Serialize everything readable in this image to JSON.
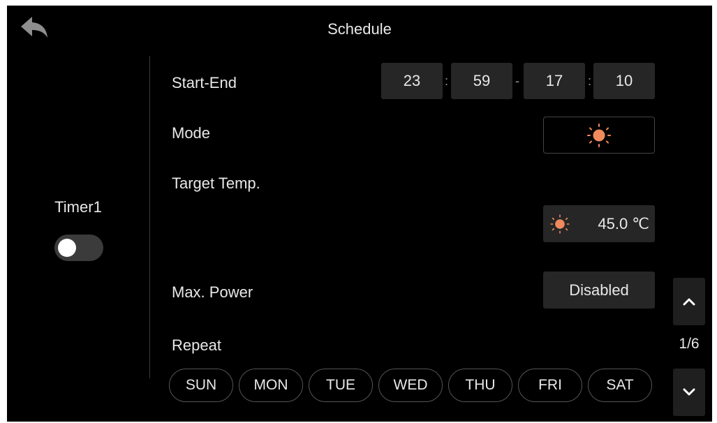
{
  "header": {
    "title": "Schedule",
    "back_icon": "back-arrow-icon"
  },
  "timer": {
    "label": "Timer1",
    "enabled": false
  },
  "start_end": {
    "label": "Start-End",
    "start_hour": "23",
    "start_minute": "59",
    "end_hour": "17",
    "end_minute": "10",
    "time_separator": ":",
    "range_separator": "-"
  },
  "mode": {
    "label": "Mode",
    "icon": "sun-heat-icon"
  },
  "target_temp": {
    "label": "Target Temp.",
    "value": "45.0 ℃",
    "icon": "sun-heat-icon"
  },
  "max_power": {
    "label": "Max. Power",
    "value": "Disabled"
  },
  "repeat": {
    "label": "Repeat",
    "days": [
      "SUN",
      "MON",
      "TUE",
      "WED",
      "THU",
      "FRI",
      "SAT"
    ]
  },
  "pagination": {
    "indicator": "1/6",
    "up_icon": "chevron-up-icon",
    "down_icon": "chevron-down-icon"
  },
  "colors": {
    "background": "#000000",
    "panel": "#262626",
    "accent": "#f08a5d",
    "text": "#e8e8e8"
  }
}
